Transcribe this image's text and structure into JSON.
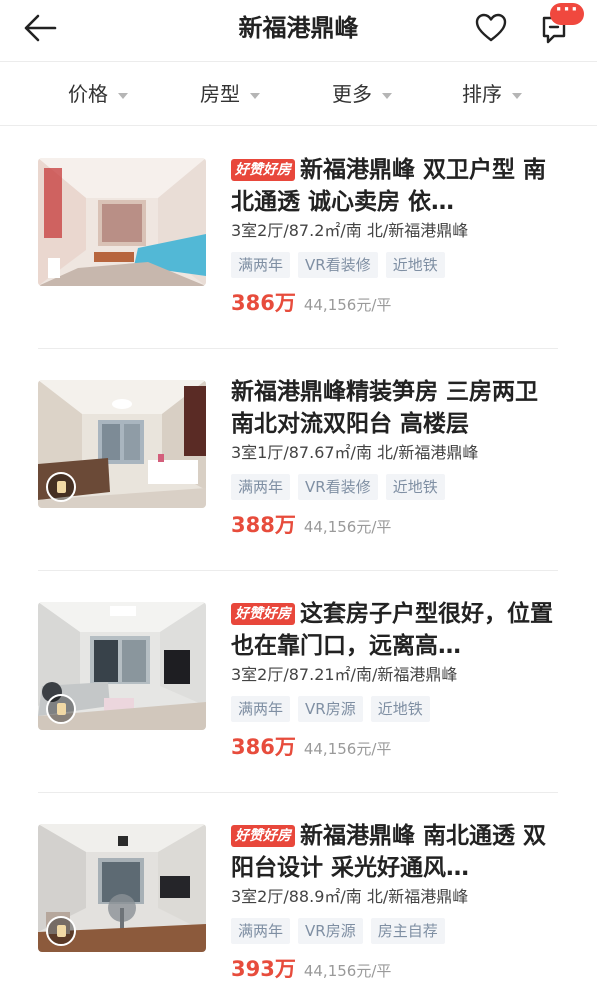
{
  "header": {
    "title": "新福港鼎峰",
    "back_icon": "back-arrow-icon",
    "favorite_icon": "heart-icon",
    "message_icon": "message-icon",
    "message_badge": "···"
  },
  "filters": [
    {
      "label": "价格"
    },
    {
      "label": "房型"
    },
    {
      "label": "更多"
    },
    {
      "label": "排序"
    }
  ],
  "listings": [
    {
      "badge": "好赞好房",
      "title": "新福港鼎峰 双卫户型 南北通透 诚心卖房 依…",
      "meta": "3室2厅/87.2㎡/南 北/新福港鼎峰",
      "tags": [
        "满两年",
        "VR看装修",
        "近地铁"
      ],
      "price": "386万",
      "unit_price": "44,156元/平",
      "has_vr": false
    },
    {
      "badge": "",
      "title": "新福港鼎峰精装笋房 三房两卫 南北对流双阳台 高楼层",
      "meta": "3室1厅/87.67㎡/南 北/新福港鼎峰",
      "tags": [
        "满两年",
        "VR看装修",
        "近地铁"
      ],
      "price": "388万",
      "unit_price": "44,156元/平",
      "has_vr": true
    },
    {
      "badge": "好赞好房",
      "title": "这套房子户型很好，位置也在靠门口，远离高…",
      "meta": "3室2厅/87.21㎡/南/新福港鼎峰",
      "tags": [
        "满两年",
        "VR房源",
        "近地铁"
      ],
      "price": "386万",
      "unit_price": "44,156元/平",
      "has_vr": true
    },
    {
      "badge": "好赞好房",
      "title": "新福港鼎峰 南北通透 双阳台设计 采光好通风…",
      "meta": "3室2厅/88.9㎡/南 北/新福港鼎峰",
      "tags": [
        "满两年",
        "VR房源",
        "房主自荐"
      ],
      "price": "393万",
      "unit_price": "44,156元/平",
      "has_vr": true
    }
  ],
  "colors": {
    "price": "#e74c3c",
    "hot_badge": "#e8473b",
    "tag_text": "#7f8fa3",
    "tag_bg": "#f2f4f7",
    "message_badge": "#f0483e"
  }
}
